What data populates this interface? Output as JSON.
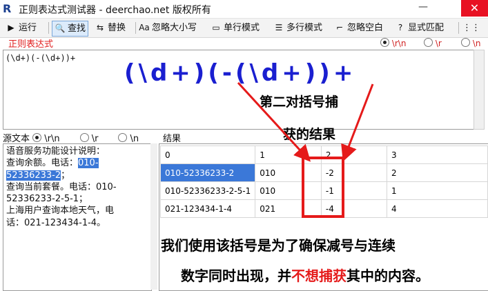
{
  "window": {
    "app_icon": "R",
    "title": "正则表达式测试器 - deerchao.net 版权所有",
    "minimize": "—",
    "close": "✕"
  },
  "toolbar": {
    "run": "运行",
    "find": "查找",
    "replace": "替换",
    "ignore_case": "忽略大小写",
    "single_line": "单行模式",
    "multi_line": "多行模式",
    "ignore_space": "忽略空白",
    "explicit": "显式匹配"
  },
  "regex": {
    "label": "正则表达式",
    "newline_options": [
      "\\r\\n",
      "\\r",
      "\\n"
    ],
    "value": "(\\d+)(-(\\d+))+",
    "big_display": "(\\d+)(-(\\d+))+"
  },
  "annotations": {
    "line1": "第二对括号捕",
    "line2": "获的结果"
  },
  "source": {
    "label": "源文本",
    "newline_options": [
      "\\r\\n",
      "\\r",
      "\\n"
    ],
    "lines": [
      {
        "before": "语音服务功能设计说明：",
        "hl": "",
        "after": ""
      },
      {
        "before": "查询余额。电话：",
        "hl": "010-",
        "after": ""
      },
      {
        "before": "",
        "hl": "52336233-2",
        "after": "；"
      },
      {
        "before": "查询当前套餐。电话：010-",
        "hl": "",
        "after": ""
      },
      {
        "before": "52336233-2-5-1；",
        "hl": "",
        "after": ""
      },
      {
        "before": "上海用户查询本地天气，电",
        "hl": "",
        "after": ""
      },
      {
        "before": "话：021-123434-1-4。",
        "hl": "",
        "after": ""
      }
    ]
  },
  "results": {
    "label": "结果",
    "headers": [
      "0",
      "1",
      "2",
      "3"
    ],
    "rows": [
      [
        "010-52336233-2",
        "010",
        "-2",
        "2"
      ],
      [
        "010-52336233-2-5-1",
        "010",
        "-1",
        "1"
      ],
      [
        "021-123434-1-4",
        "021",
        "-4",
        "4"
      ]
    ]
  },
  "note": {
    "line1": "我们使用该括号是为了确保减号与连续",
    "line2_pre": "数字同时出现，并",
    "line2_red": "不想捕获",
    "line2_post": "其中的内容。"
  }
}
